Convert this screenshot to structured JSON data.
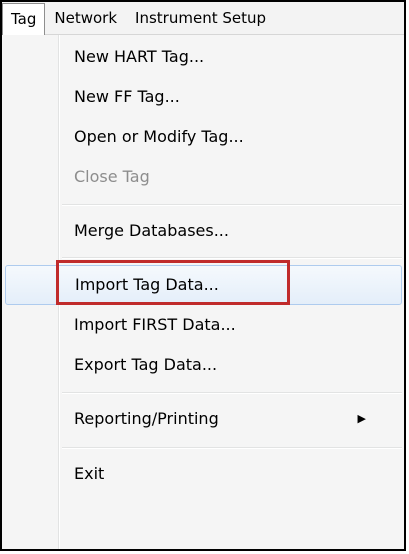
{
  "menubar": {
    "items": [
      {
        "label": "Tag",
        "active": true
      },
      {
        "label": "Network",
        "active": false
      },
      {
        "label": "Instrument Setup",
        "active": false
      }
    ]
  },
  "tag_menu": {
    "new_hart_tag": "New HART Tag...",
    "new_ff_tag": "New FF Tag...",
    "open_modify_tag": "Open or Modify Tag...",
    "close_tag": "Close Tag",
    "merge_databases": "Merge Databases...",
    "import_tag_data": "Import Tag Data...",
    "import_first_data": "Import FIRST Data...",
    "export_tag_data": "Export Tag Data...",
    "reporting_printing": "Reporting/Printing",
    "exit": "Exit"
  },
  "icons": {
    "submenu_arrow": "chevron-right-icon"
  },
  "colors": {
    "highlight_border": "#aecbee",
    "focus_box": "#c02b2b",
    "disabled_text": "#8d8d8d"
  }
}
